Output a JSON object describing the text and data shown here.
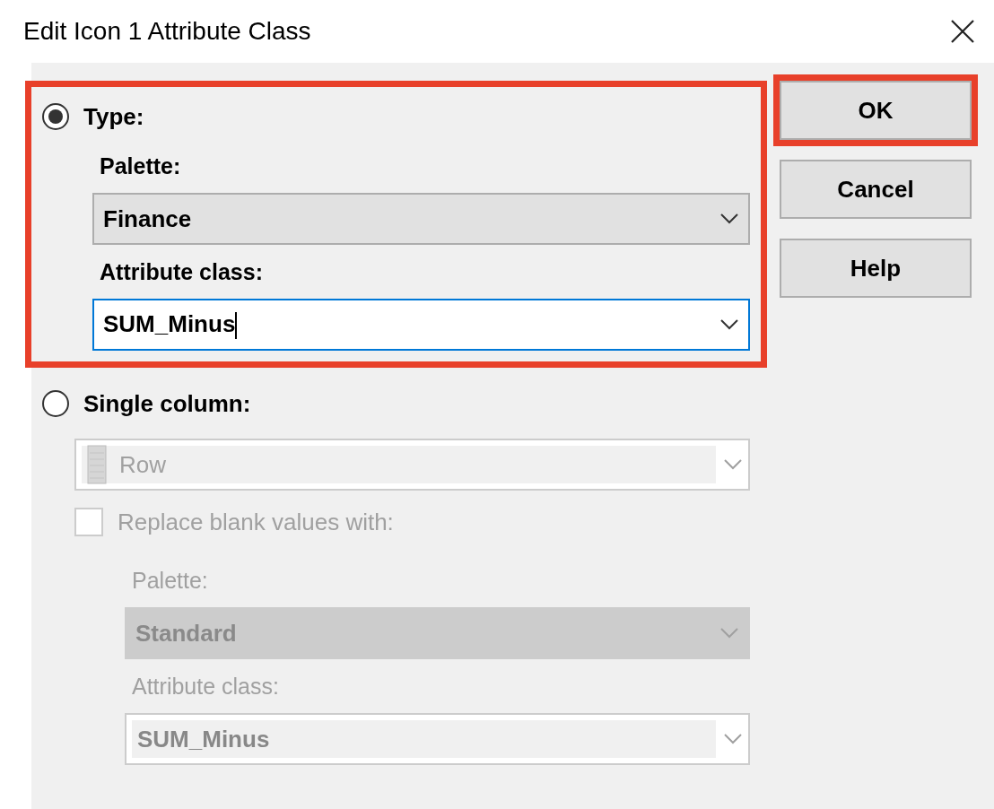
{
  "window": {
    "title": "Edit Icon 1 Attribute Class"
  },
  "type_option": {
    "label": "Type:",
    "selected": true,
    "highlighted": true,
    "palette": {
      "label": "Palette:",
      "value": "Finance"
    },
    "attribute_class": {
      "label": "Attribute class:",
      "value": "SUM_Minus",
      "focused": true
    }
  },
  "single_column_option": {
    "label": "Single column:",
    "selected": false,
    "disabled": true,
    "column": {
      "value": "Row"
    },
    "replace_blank": {
      "label": "Replace blank values with:",
      "checked": false
    },
    "palette": {
      "label": "Palette:",
      "value": "Standard"
    },
    "attribute_class": {
      "label": "Attribute class:",
      "value": "SUM_Minus"
    }
  },
  "buttons": [
    {
      "label": "OK",
      "highlighted": true
    },
    {
      "label": "Cancel",
      "highlighted": false
    },
    {
      "label": "Help",
      "highlighted": false
    }
  ]
}
